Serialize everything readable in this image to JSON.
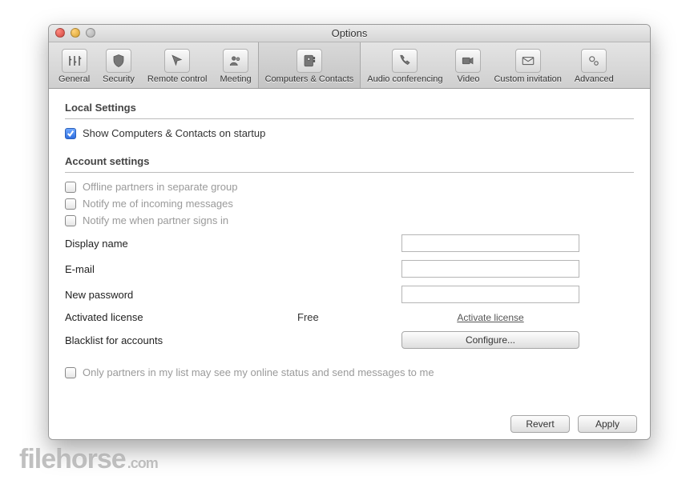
{
  "window": {
    "title": "Options"
  },
  "toolbar": {
    "items": [
      {
        "label": "General"
      },
      {
        "label": "Security"
      },
      {
        "label": "Remote control"
      },
      {
        "label": "Meeting"
      },
      {
        "label": "Computers & Contacts"
      },
      {
        "label": "Audio conferencing"
      },
      {
        "label": "Video"
      },
      {
        "label": "Custom invitation"
      },
      {
        "label": "Advanced"
      }
    ]
  },
  "sections": {
    "local": {
      "title": "Local Settings",
      "show_on_startup": "Show Computers & Contacts on startup"
    },
    "account": {
      "title": "Account settings",
      "offline_partners": "Offline partners in separate group",
      "notify_incoming": "Notify me of incoming messages",
      "notify_signin": "Notify me when partner signs in",
      "display_name_label": "Display name",
      "email_label": "E-mail",
      "new_password_label": "New password",
      "activated_license_label": "Activated license",
      "activated_license_value": "Free",
      "activate_link": "Activate license",
      "blacklist_label": "Blacklist for accounts",
      "configure_button": "Configure...",
      "only_partners": "Only partners in my list may see my online status and send messages to me",
      "display_name_value": "",
      "email_value": "",
      "new_password_value": ""
    }
  },
  "buttons": {
    "revert": "Revert",
    "apply": "Apply"
  },
  "watermark": {
    "name": "filehorse",
    "tld": ".com"
  }
}
